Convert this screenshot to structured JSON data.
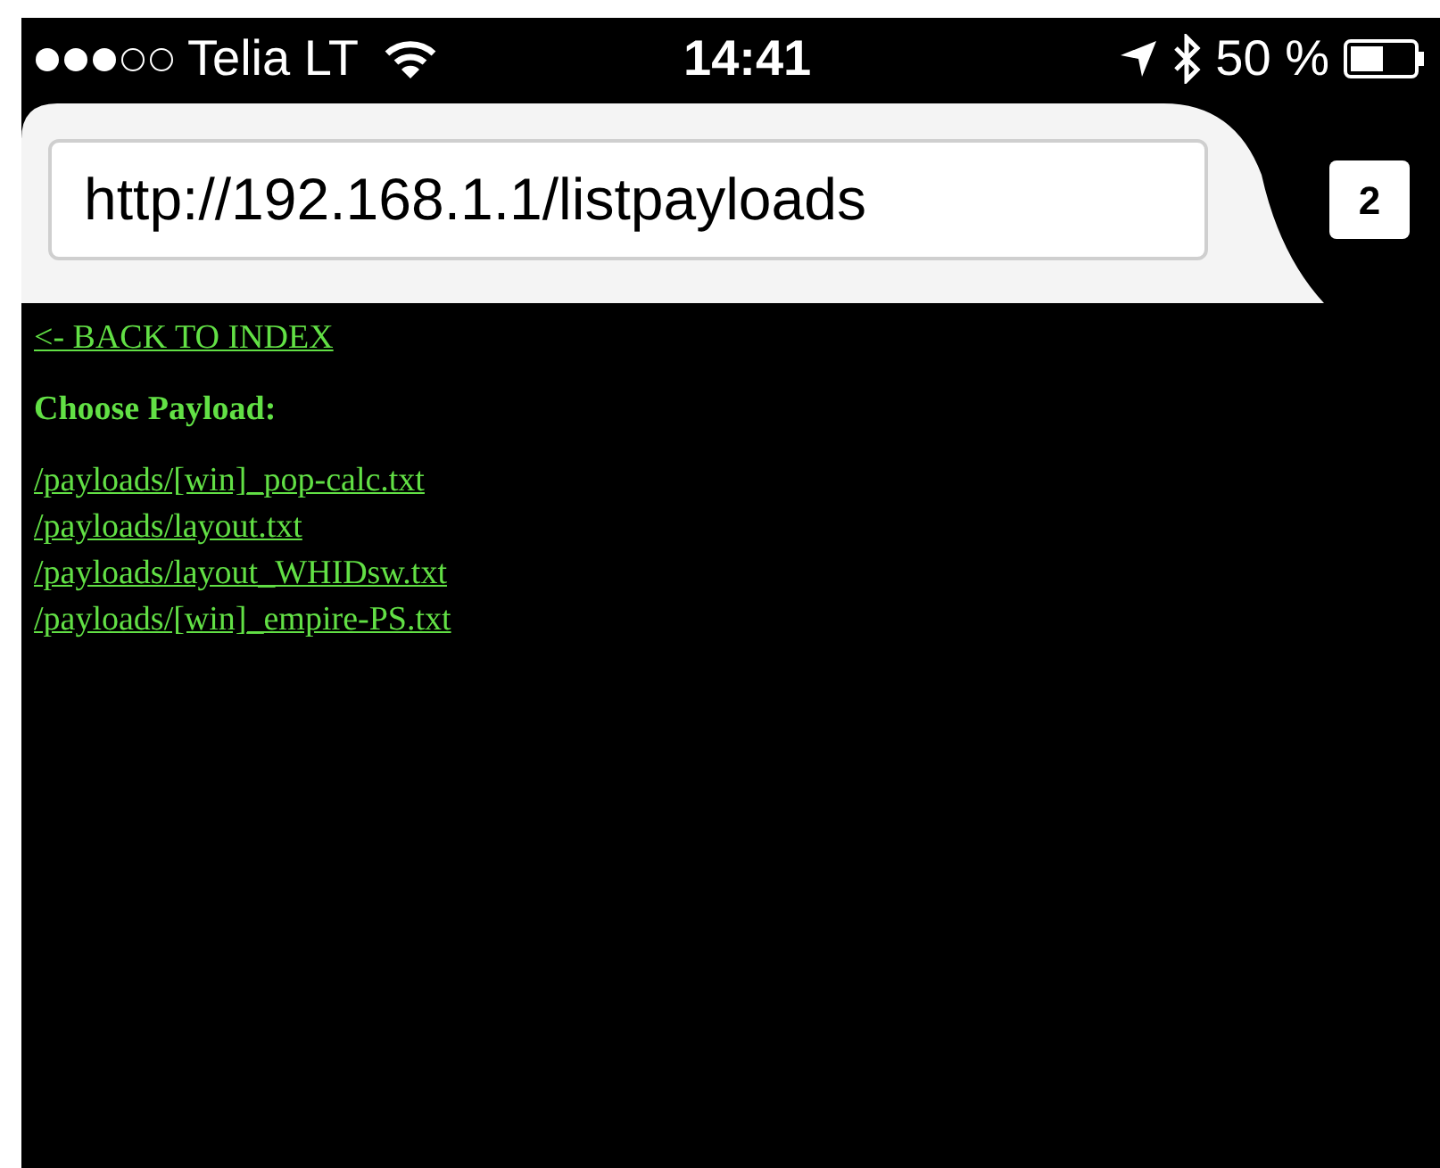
{
  "status_bar": {
    "signal_dots": [
      {
        "filled": true
      },
      {
        "filled": true
      },
      {
        "filled": true
      },
      {
        "filled": false
      },
      {
        "filled": false
      }
    ],
    "carrier": "Telia LT",
    "time": "14:41",
    "battery": "50 %"
  },
  "address_bar": {
    "url": "http://192.168.1.1/listpayloads",
    "tab_count": "2"
  },
  "page": {
    "back_link": "<- BACK TO INDEX",
    "heading": "Choose Payload:",
    "links": [
      "/payloads/[win]_pop-calc.txt",
      "/payloads/layout.txt",
      "/payloads/layout_WHIDsw.txt",
      "/payloads/[win]_empire-PS.txt"
    ]
  }
}
